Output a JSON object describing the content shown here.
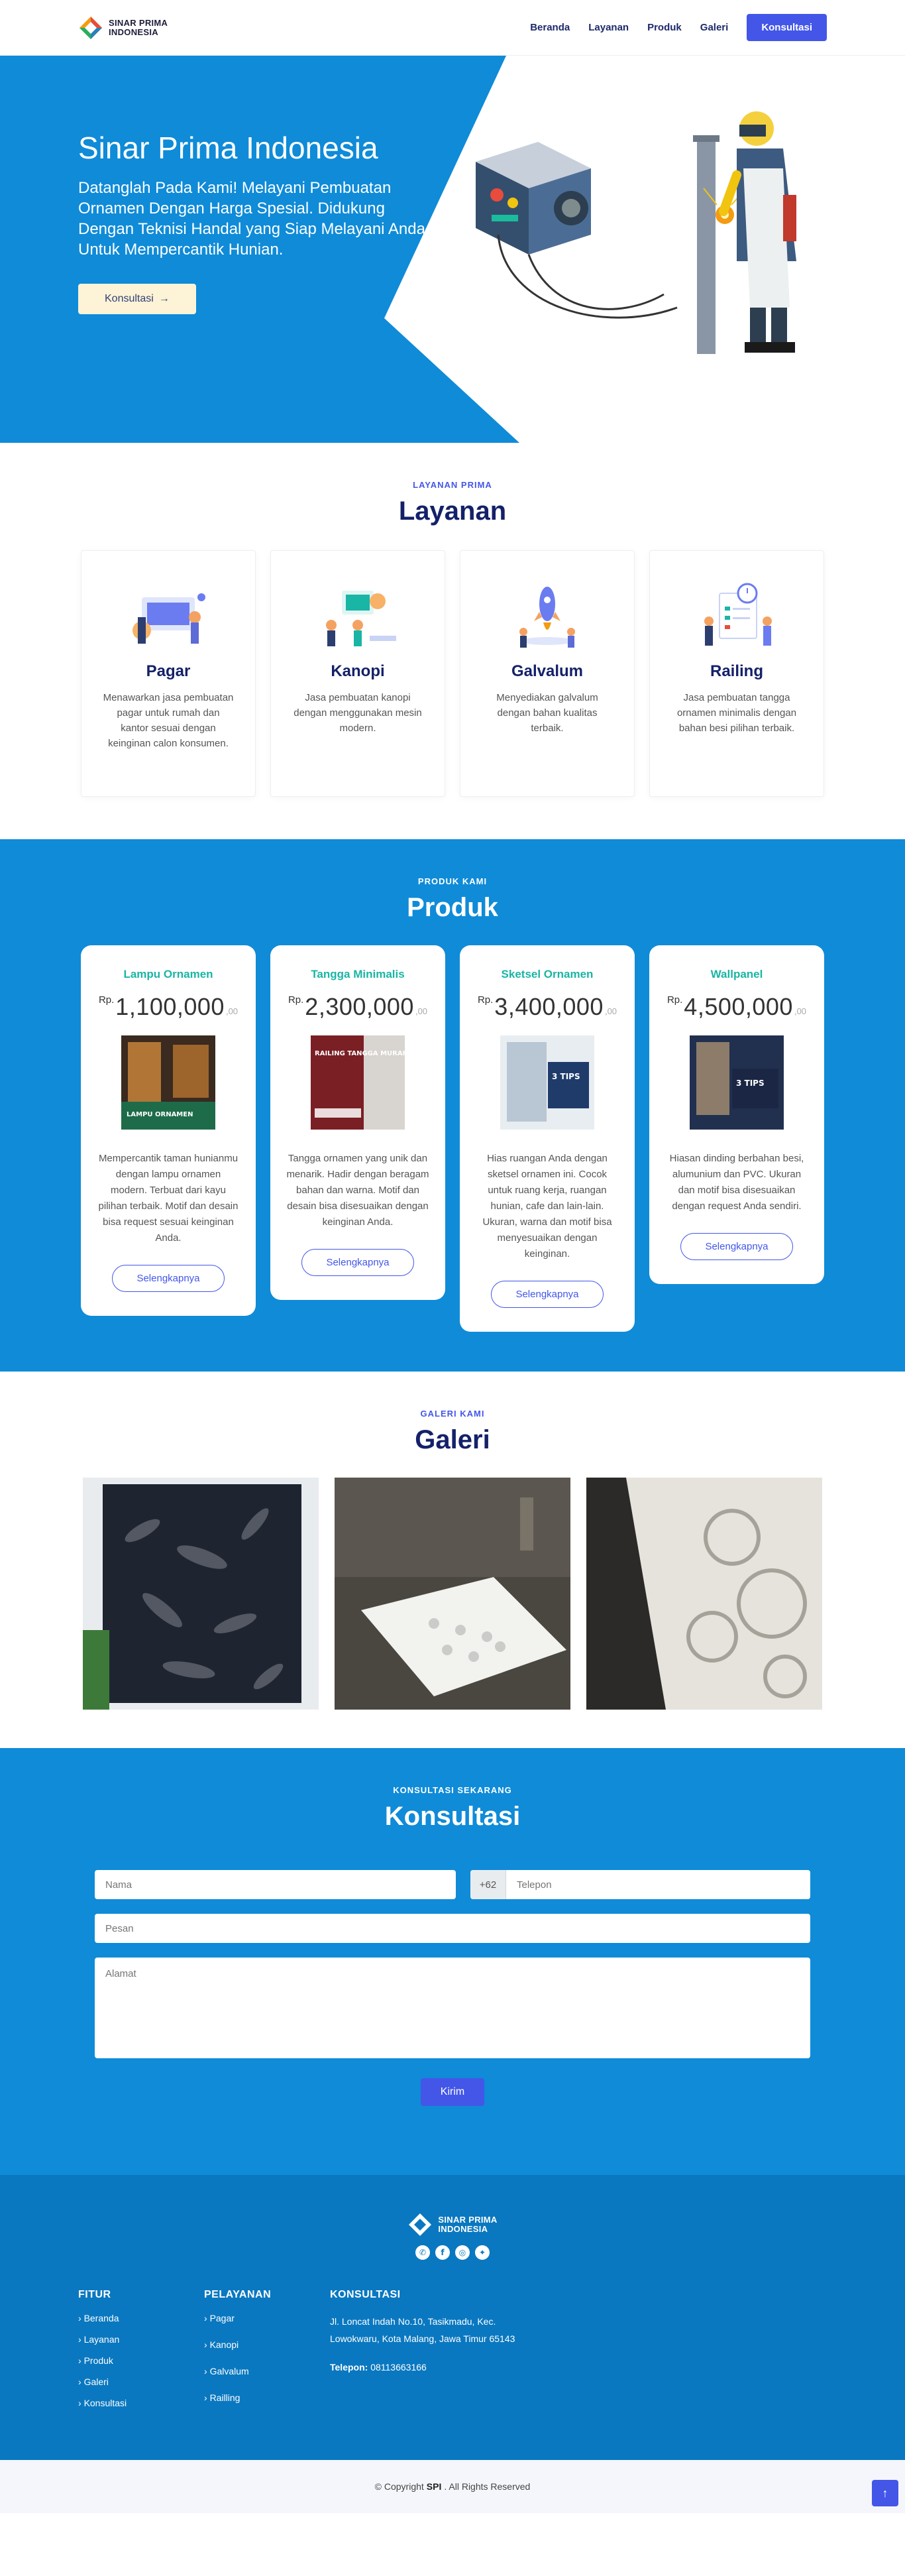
{
  "header": {
    "logo_line1": "SINAR PRIMA",
    "logo_line2": "INDONESIA",
    "nav": [
      "Beranda",
      "Layanan",
      "Produk",
      "Galeri"
    ],
    "cta": "Konsultasi"
  },
  "hero": {
    "title": "Sinar Prima Indonesia",
    "subtitle": "Datanglah Pada Kami! Melayani Pembuatan Ornamen Dengan Harga Spesial. Didukung Dengan Teknisi Handal yang Siap Melayani Anda Untuk Mempercantik Hunian.",
    "button": "Konsultasi",
    "button_icon": "arrow-right-icon"
  },
  "layanan": {
    "eyebrow": "LAYANAN PRIMA",
    "title": "Layanan",
    "cards": [
      {
        "title": "Pagar",
        "desc": "Menawarkan jasa pembuatan pagar untuk rumah dan kantor sesuai dengan keinginan calon konsumen."
      },
      {
        "title": "Kanopi",
        "desc": "Jasa pembuatan kanopi dengan menggunakan mesin modern."
      },
      {
        "title": "Galvalum",
        "desc": "Menyediakan galvalum dengan bahan kualitas terbaik."
      },
      {
        "title": "Railing",
        "desc": "Jasa pembuatan tangga ornamen minimalis dengan bahan besi pilihan terbaik."
      }
    ]
  },
  "produk": {
    "eyebrow": "PRODUK KAMI",
    "title": "Produk",
    "currency": "Rp.",
    "decimals": ",00",
    "button": "Selengkapnya",
    "items": [
      {
        "name": "Lampu Ornamen",
        "price": "1,100,000",
        "desc": "Mempercantik taman hunianmu dengan lampu ornamen modern. Terbuat dari kayu pilihan terbaik. Motif dan desain bisa request sesuai keinginan Anda.",
        "img_text": "LAMPU ORNAMEN"
      },
      {
        "name": "Tangga Minimalis",
        "price": "2,300,000",
        "desc": "Tangga ornamen yang unik dan menarik. Hadir dengan beragam bahan dan warna. Motif dan desain bisa disesuaikan dengan keinginan Anda.",
        "img_text": "RAILING TANGGA MURAH"
      },
      {
        "name": "Sketsel Ornamen",
        "price": "3,400,000",
        "desc": "Hias ruangan Anda dengan sketsel ornamen ini. Cocok untuk ruang kerja, ruangan hunian, cafe dan lain-lain. Ukuran, warna dan motif bisa menyesuaikan dengan keinginan.",
        "img_text": "3 TIPS"
      },
      {
        "name": "Wallpanel",
        "price": "4,500,000",
        "desc": "Hiasan dinding berbahan besi, alumunium dan PVC. Ukuran dan motif bisa disesuaikan dengan request Anda sendiri.",
        "img_text": "3 TIPS"
      }
    ]
  },
  "galeri": {
    "eyebrow": "GALERI KAMI",
    "title": "Galeri"
  },
  "konsultasi": {
    "eyebrow": "KONSULTASI SEKARANG",
    "title": "Konsultasi",
    "name_placeholder": "Nama",
    "phone_prefix": "+62",
    "phone_placeholder": "Telepon",
    "message_placeholder": "Pesan",
    "address_placeholder": "Alamat",
    "submit": "Kirim"
  },
  "footer": {
    "logo_line1": "SINAR PRIMA",
    "logo_line2": "INDONESIA",
    "socials": [
      "whatsapp-icon",
      "facebook-icon",
      "instagram-icon",
      "twitter-icon"
    ],
    "fitur_title": "FITUR",
    "fitur_links": [
      "Beranda",
      "Layanan",
      "Produk",
      "Galeri",
      "Konsultasi"
    ],
    "pelayanan_title": "PELAYANAN",
    "pelayanan_links": [
      "Pagar",
      "Kanopi",
      "Galvalum",
      "Railling"
    ],
    "kontak_title": "KONSULTASI",
    "address": "Jl. Loncat Indah No.10, Tasikmadu, Kec. Lowokwaru, Kota Malang, Jawa Timur 65143",
    "phone_label": "Telepon:",
    "phone_value": "08113663166"
  },
  "copyright": {
    "prefix": "© Copyright",
    "brand": "SPI",
    "suffix": ". All Rights Reserved"
  },
  "colors": {
    "primary_blue": "#0f8bd8",
    "accent": "#4356e8",
    "navy": "#142169",
    "teal": "#19b5a5"
  }
}
